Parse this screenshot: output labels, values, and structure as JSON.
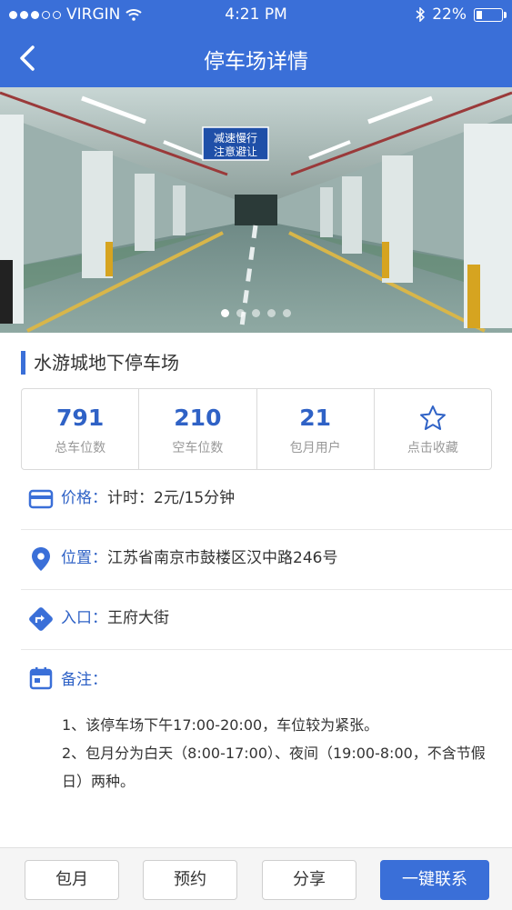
{
  "status_bar": {
    "carrier": "VIRGIN",
    "time": "4:21 PM",
    "battery": "22%",
    "battery_level": 0.22
  },
  "nav": {
    "title": "停车场详情",
    "back_icon": "chevron-left-icon"
  },
  "hero": {
    "sign_text_line1": "减速慢行",
    "sign_text_line2": "注意避让",
    "pages": 5,
    "active_page": 1
  },
  "lot": {
    "name": "水游城地下停车场"
  },
  "stats": [
    {
      "value": "791",
      "label": "总车位数"
    },
    {
      "value": "210",
      "label": "空车位数"
    },
    {
      "value": "21",
      "label": "包月用户"
    },
    {
      "icon": "star-icon",
      "label": "点击收藏"
    }
  ],
  "info": {
    "price_key": "价格：",
    "price_value": "计时：2元/15分钟",
    "location_key": "位置：",
    "location_value": "江苏省南京市鼓楼区汉中路246号",
    "entrance_key": "入口：",
    "entrance_value": "王府大街",
    "note_key": "备注："
  },
  "notes": [
    "1、该停车场下午17:00-20:00，车位较为紧张。",
    "2、包月分为白天（8:00-17:00）、夜间（19:00-8:00，不含节假日）两种。"
  ],
  "buttons": {
    "monthly": "包月",
    "reserve": "预约",
    "share": "分享",
    "contact": "一键联系"
  },
  "colors": {
    "primary": "#3a6fd8",
    "number": "#2f62c6"
  }
}
